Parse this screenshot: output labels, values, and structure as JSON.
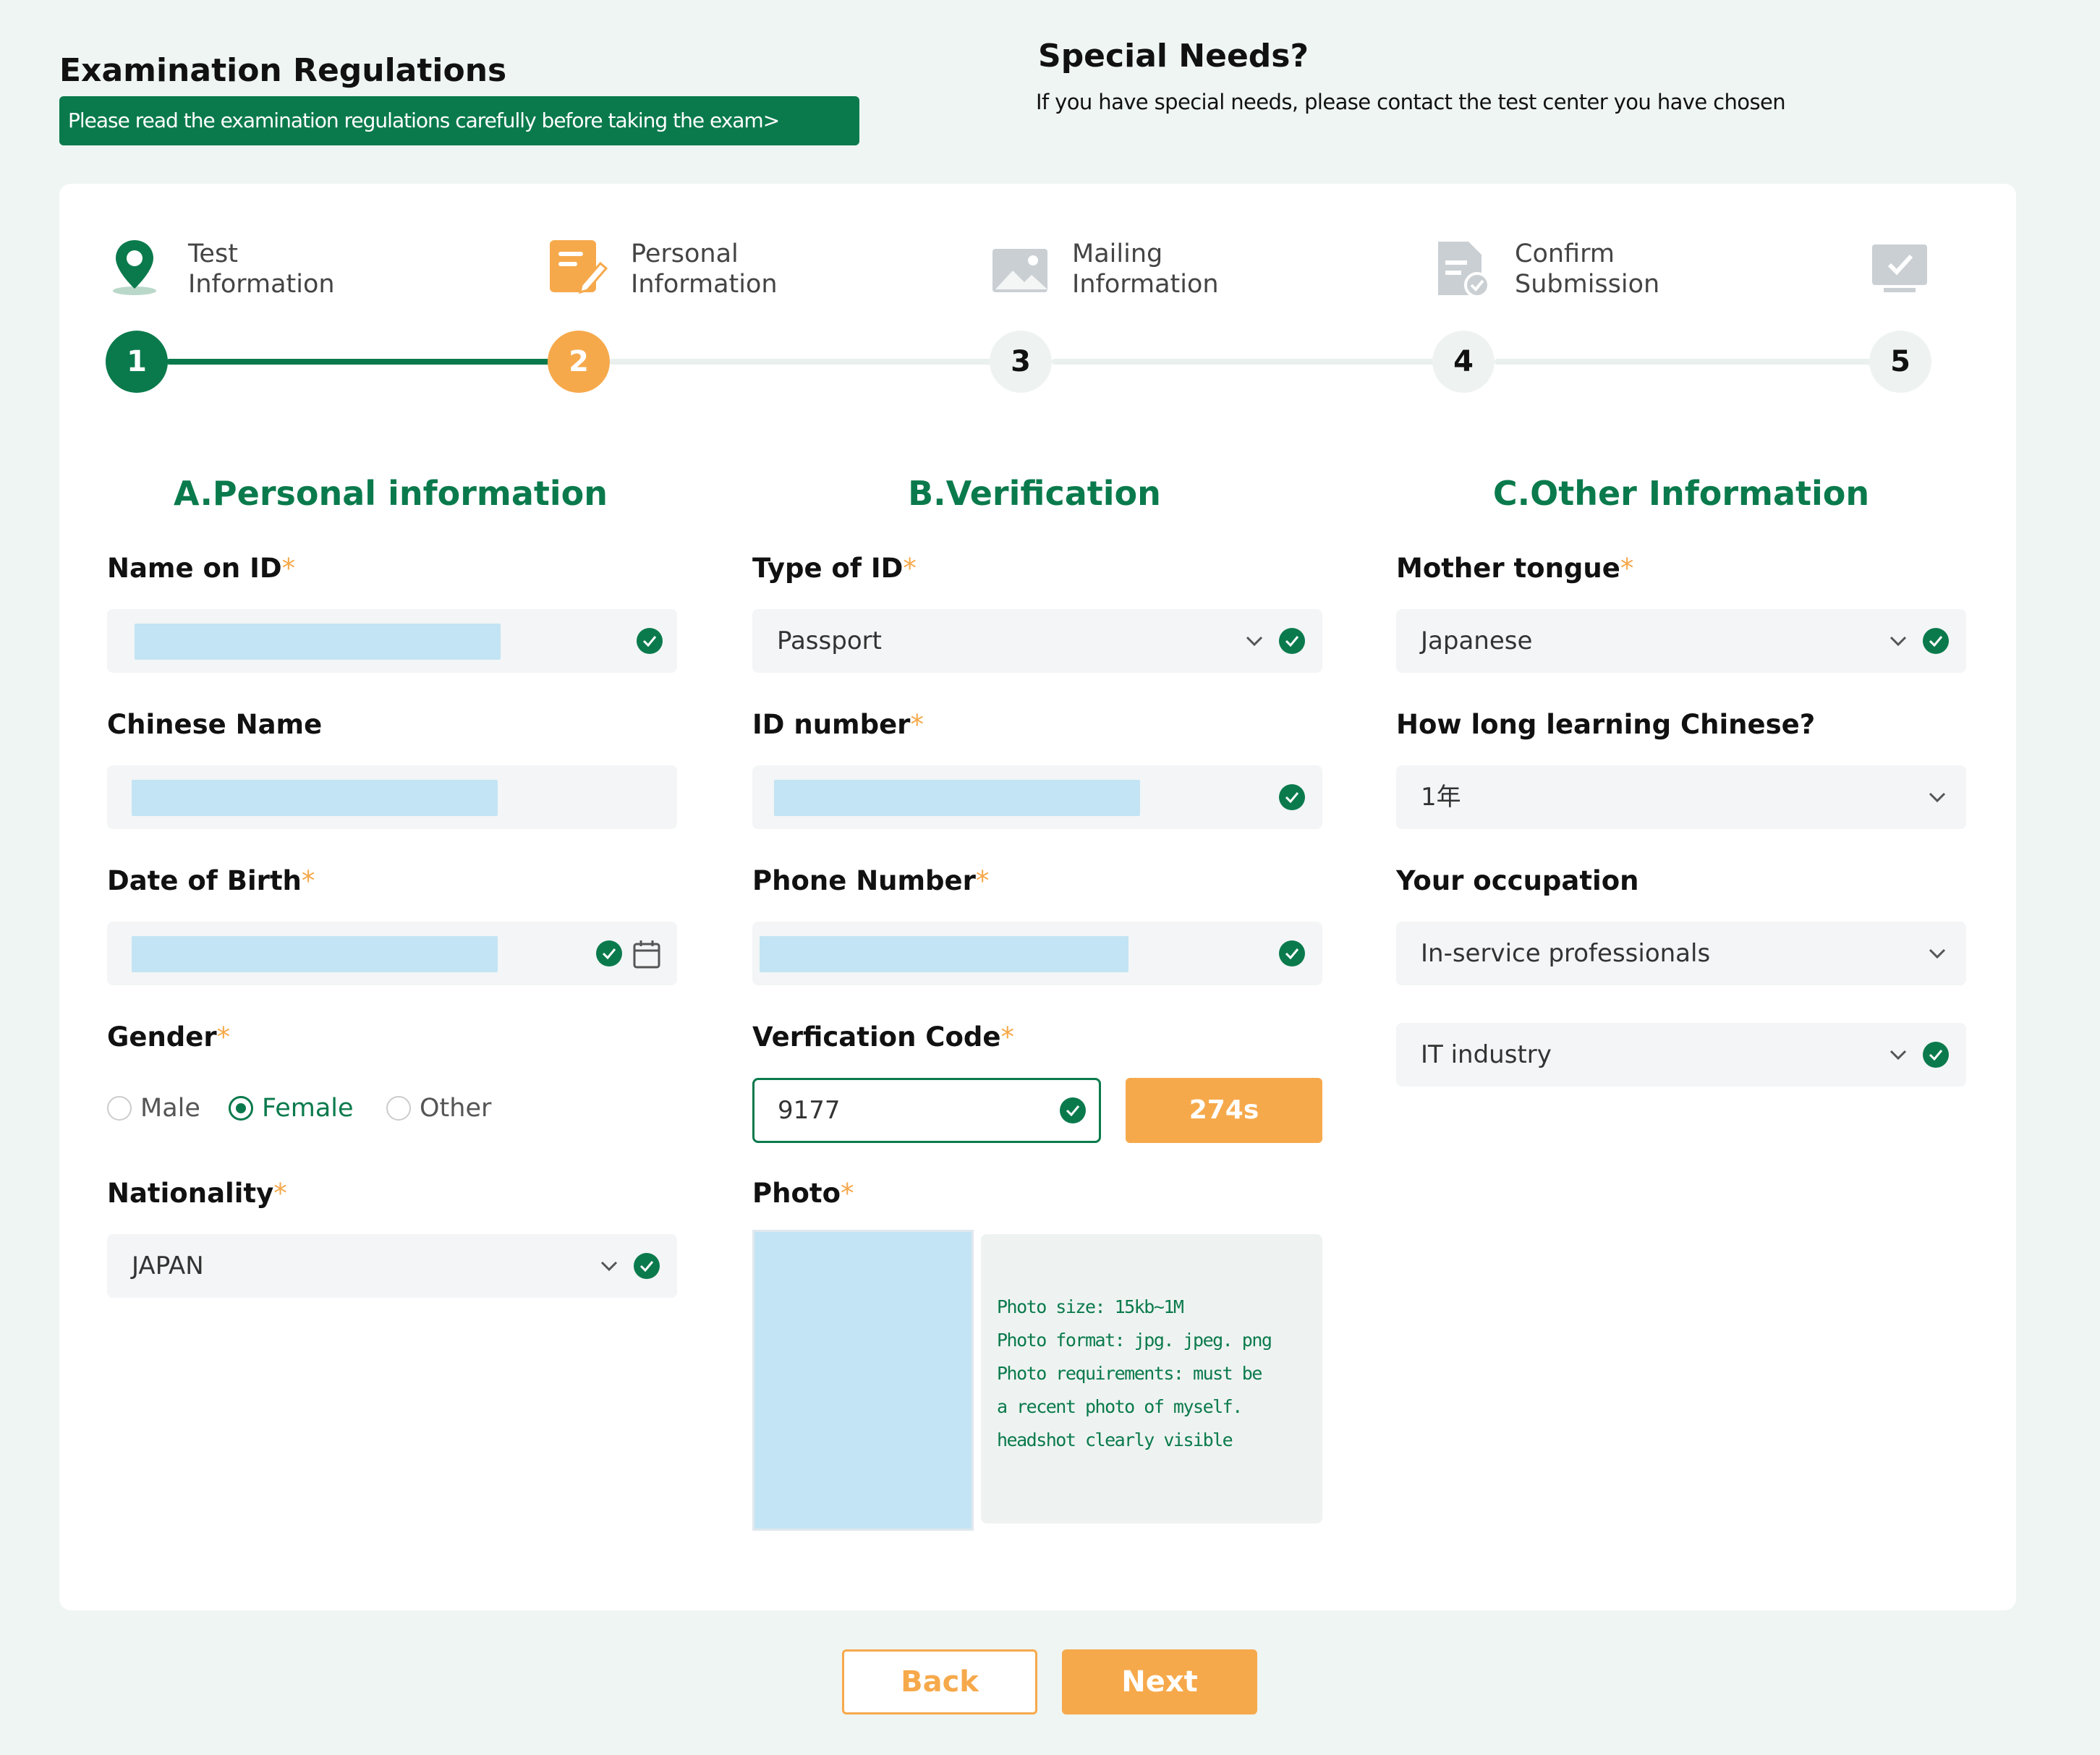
{
  "header": {
    "regulations_title": "Examination Regulations",
    "regulations_banner": "Please read the examination regulations carefully before taking the exam>",
    "special_needs_title": "Special Needs?",
    "special_needs_text": "If you have special needs, please contact the test center you have chosen"
  },
  "steps": [
    {
      "number": "1",
      "label": "Test\nInformation",
      "icon": "location-pin-icon",
      "state": "done"
    },
    {
      "number": "2",
      "label": "Personal\nInformation",
      "icon": "edit-form-icon",
      "state": "active"
    },
    {
      "number": "3",
      "label": "Mailing\nInformation",
      "icon": "mail-image-icon",
      "state": "pending"
    },
    {
      "number": "4",
      "label": "Confirm\nSubmission",
      "icon": "document-check-icon",
      "state": "pending"
    },
    {
      "number": "5",
      "label": "",
      "icon": "monitor-check-icon",
      "state": "pending"
    }
  ],
  "sections": {
    "a_title": "A.Personal information",
    "b_title": "B.Verification",
    "c_title": "C.Other Information"
  },
  "personal": {
    "name_label": "Name on ID",
    "chinese_name_label": "Chinese Name",
    "dob_label": "Date of Birth",
    "gender_label": "Gender",
    "gender_options": [
      "Male",
      "Female",
      "Other"
    ],
    "gender_selected": "Female",
    "nationality_label": "Nationality",
    "nationality_value": "JAPAN"
  },
  "verification": {
    "id_type_label": "Type of ID",
    "id_type_value": "Passport",
    "id_number_label": "ID number",
    "phone_label": "Phone Number",
    "code_label": "Verfication Code",
    "code_value": "9177",
    "timer_label": "274s",
    "photo_label": "Photo",
    "photo_info": [
      "Photo size: 15kb~1M",
      "Photo format: jpg. jpeg. png",
      "Photo requirements: must be",
      "a recent photo of myself.",
      "headshot clearly visible"
    ]
  },
  "other": {
    "mother_tongue_label": "Mother tongue",
    "mother_tongue_value": "Japanese",
    "learning_label": "How long learning Chinese?",
    "learning_value": "1年",
    "occupation_label": "Your occupation",
    "occupation_value": "In-service professionals",
    "industry_value": "IT industry"
  },
  "buttons": {
    "back": "Back",
    "next": "Next"
  },
  "colors": {
    "primary_green": "#0a7a4c",
    "accent_orange": "#f6a94b",
    "background": "#eff5f3"
  }
}
